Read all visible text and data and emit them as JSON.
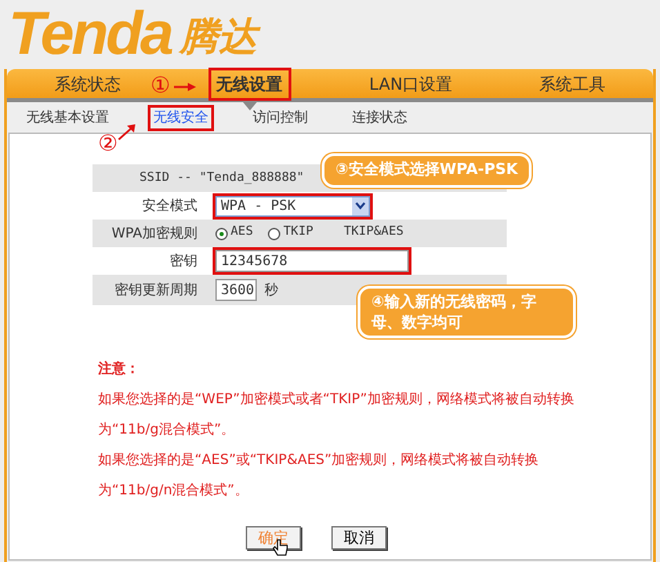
{
  "logo": {
    "brand": "Tenda",
    "chinese": "腾达"
  },
  "nav": [
    {
      "label": "系统状态",
      "selected": false,
      "boxed": false
    },
    {
      "label": "无线设置",
      "selected": true,
      "boxed": true
    },
    {
      "label": "LAN口设置",
      "selected": false,
      "boxed": false
    },
    {
      "label": "系统工具",
      "selected": false,
      "boxed": false
    }
  ],
  "subnav": [
    {
      "label": "无线基本设置",
      "selected": false,
      "boxed": false
    },
    {
      "label": "无线安全",
      "selected": true,
      "boxed": true
    },
    {
      "label": "访问控制",
      "selected": false,
      "boxed": false
    },
    {
      "label": "连接状态",
      "selected": false,
      "boxed": false
    }
  ],
  "form": {
    "ssid": "SSID -- \"Tenda_888888\"",
    "mode": {
      "label": "安全模式",
      "value": "WPA - PSK",
      "boxed": true
    },
    "rule": {
      "label": "WPA加密规则",
      "options": [
        {
          "label": "AES",
          "kind": "radio",
          "checked": true
        },
        {
          "label": "TKIP",
          "kind": "radio",
          "checked": false
        },
        {
          "label": "TKIP&AES",
          "kind": "text"
        }
      ]
    },
    "key": {
      "label": "密钥",
      "value": "12345678",
      "boxed": true
    },
    "period": {
      "label": "密钥更新周期",
      "value": "3600",
      "unit": "秒"
    }
  },
  "notes": {
    "title": "注意：",
    "lines": [
      "如果您选择的是“WEP”加密模式或者“TKIP”加密规则，网络模式将被自动转换为“11b/g混合模式”。",
      "如果您选择的是“AES”或“TKIP&AES”加密规则，网络模式将被自动转换为“11b/g/n混合模式”。"
    ]
  },
  "buttons": [
    {
      "label": "确定",
      "hovered": true
    },
    {
      "label": "取消",
      "hovered": false
    }
  ],
  "annotations": {
    "step1": "①",
    "step2": "②",
    "callout3": "③安全模式选择WPA-PSK",
    "callout4": "④输入新的无线密码，字母、数字均可"
  }
}
